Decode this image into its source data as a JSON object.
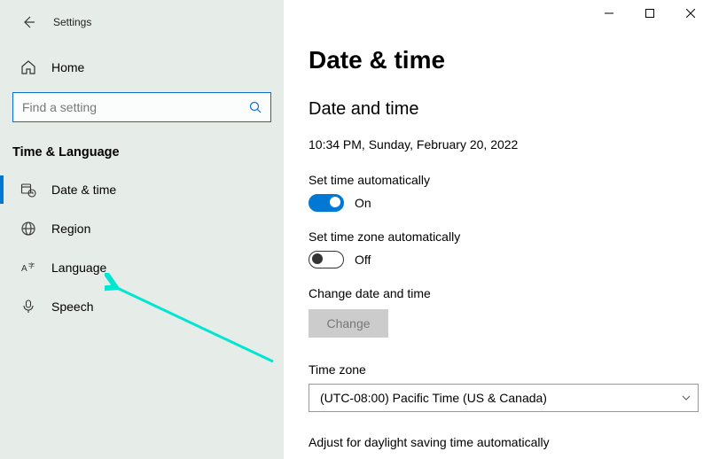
{
  "app": {
    "title": "Settings"
  },
  "sidebar": {
    "home": "Home",
    "search_placeholder": "Find a setting",
    "category": "Time & Language",
    "items": [
      {
        "label": "Date & time"
      },
      {
        "label": "Region"
      },
      {
        "label": "Language"
      },
      {
        "label": "Speech"
      }
    ]
  },
  "main": {
    "page_title": "Date & time",
    "section_title": "Date and time",
    "current_datetime": "10:34 PM, Sunday, February 20, 2022",
    "set_time_auto_label": "Set time automatically",
    "set_time_auto_state": "On",
    "set_tz_auto_label": "Set time zone automatically",
    "set_tz_auto_state": "Off",
    "change_dt_label": "Change date and time",
    "change_button": "Change",
    "tz_label": "Time zone",
    "tz_value": "(UTC-08:00) Pacific Time (US & Canada)",
    "dst_label": "Adjust for daylight saving time automatically"
  }
}
